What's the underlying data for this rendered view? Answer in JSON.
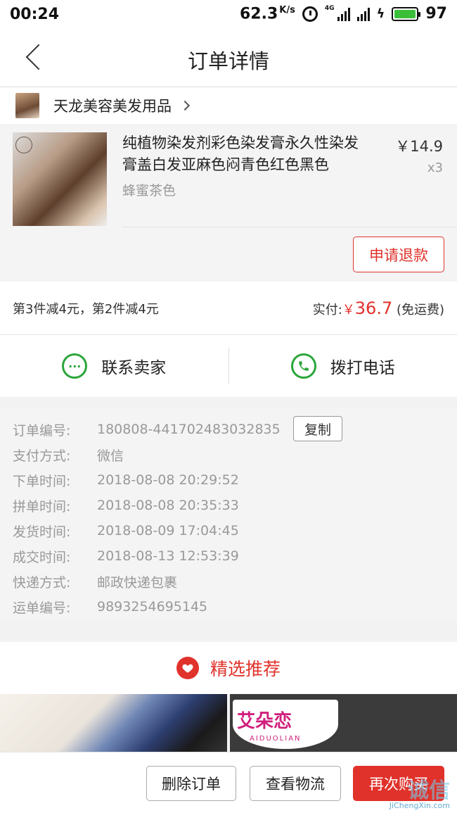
{
  "status_bar": {
    "time": "00:24",
    "net_speed": "62.3",
    "net_speed_unit": "K/s",
    "network_badge": "4G",
    "battery": "97"
  },
  "nav": {
    "title": "订单详情"
  },
  "shop": {
    "name": "天龙美容美发用品"
  },
  "product": {
    "title": "纯植物染发剂彩色染发膏永久性染发膏盖白发亚麻色闷青色红色黑色",
    "variant": "蜂蜜茶色",
    "price": "￥14.9",
    "quantity": "x3",
    "refund_label": "申请退款"
  },
  "discount": {
    "promo": "第3件减4元，第2件减4元",
    "paid_label": "实付:",
    "currency": "￥",
    "amount": "36.7",
    "shipping_note": "(免运费)"
  },
  "contact": {
    "seller_label": "联系卖家",
    "phone_label": "拨打电话"
  },
  "order_info": {
    "copy_label": "复制",
    "rows": [
      {
        "key": "订单编号:",
        "value": "180808-441702483032835"
      },
      {
        "key": "支付方式:",
        "value": "微信"
      },
      {
        "key": "下单时间:",
        "value": "2018-08-08 20:29:52"
      },
      {
        "key": "拼单时间:",
        "value": "2018-08-08 20:35:33"
      },
      {
        "key": "发货时间:",
        "value": "2018-08-09 17:04:45"
      },
      {
        "key": "成交时间:",
        "value": "2018-08-13 12:53:39"
      },
      {
        "key": "快递方式:",
        "value": "邮政快递包裹"
      },
      {
        "key": "运单编号:",
        "value": "9893254695145"
      }
    ]
  },
  "recommend": {
    "title": "精选推荐",
    "brand_text": "艾朵恋",
    "brand_sub": "AIDUOLIAN"
  },
  "bottom_bar": {
    "delete_label": "删除订单",
    "logistics_label": "查看物流",
    "rebuy_label": "再次购买"
  },
  "watermark": {
    "main": "诚信",
    "sub": "JiChengXin.com"
  },
  "colors": {
    "accent": "#e0322b",
    "wechat_green": "#2aa63a"
  }
}
